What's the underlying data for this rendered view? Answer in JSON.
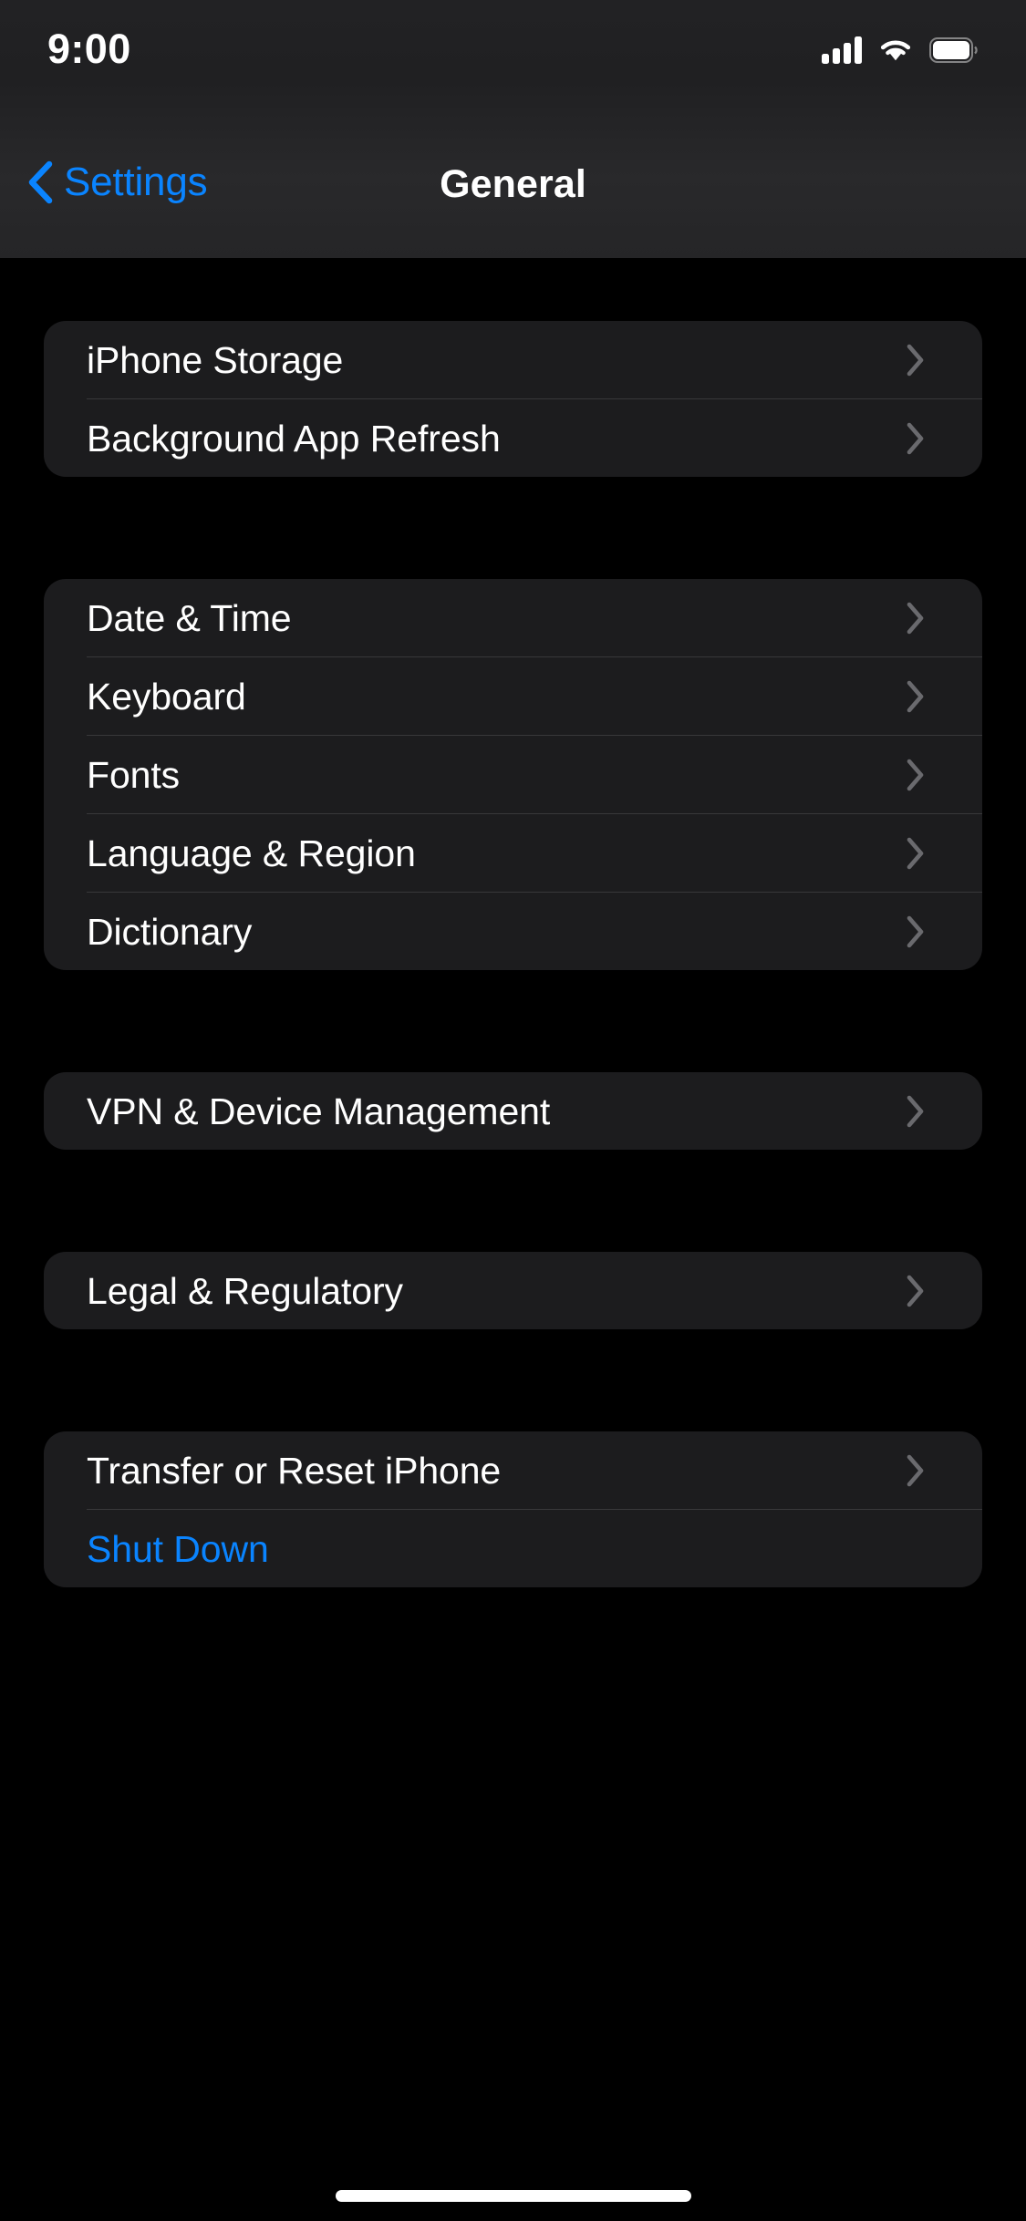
{
  "status_bar": {
    "time": "9:00",
    "cellular_icon": "cellular-signal-icon",
    "cellular_bars_filled": 4,
    "wifi_icon": "wifi-icon",
    "battery_icon": "battery-icon",
    "battery_level_percent": 100
  },
  "nav_bar": {
    "back_label": "Settings",
    "back_icon": "chevron-left-icon",
    "title": "General"
  },
  "colors": {
    "accent": "#0a84ff",
    "card_background": "#1c1c1e",
    "page_background": "#000000",
    "separator": "#38383a",
    "chevron": "#6a6a6e",
    "primary_text": "#ffffff"
  },
  "groups": [
    {
      "id": "storage-group",
      "rows": [
        {
          "label": "iPhone Storage",
          "accessory": "chevron-right-icon",
          "style": "default"
        },
        {
          "label": "Background App Refresh",
          "accessory": "chevron-right-icon",
          "style": "default"
        }
      ]
    },
    {
      "id": "localization-group",
      "rows": [
        {
          "label": "Date & Time",
          "accessory": "chevron-right-icon",
          "style": "default"
        },
        {
          "label": "Keyboard",
          "accessory": "chevron-right-icon",
          "style": "default"
        },
        {
          "label": "Fonts",
          "accessory": "chevron-right-icon",
          "style": "default"
        },
        {
          "label": "Language & Region",
          "accessory": "chevron-right-icon",
          "style": "default"
        },
        {
          "label": "Dictionary",
          "accessory": "chevron-right-icon",
          "style": "default"
        }
      ]
    },
    {
      "id": "vpn-group",
      "rows": [
        {
          "label": "VPN & Device Management",
          "accessory": "chevron-right-icon",
          "style": "default"
        }
      ]
    },
    {
      "id": "legal-group",
      "rows": [
        {
          "label": "Legal & Regulatory",
          "accessory": "chevron-right-icon",
          "style": "default"
        }
      ]
    },
    {
      "id": "reset-group",
      "rows": [
        {
          "label": "Transfer or Reset iPhone",
          "accessory": "chevron-right-icon",
          "style": "default"
        },
        {
          "label": "Shut Down",
          "accessory": "none",
          "style": "accent"
        }
      ]
    }
  ],
  "home_indicator": "home-indicator"
}
